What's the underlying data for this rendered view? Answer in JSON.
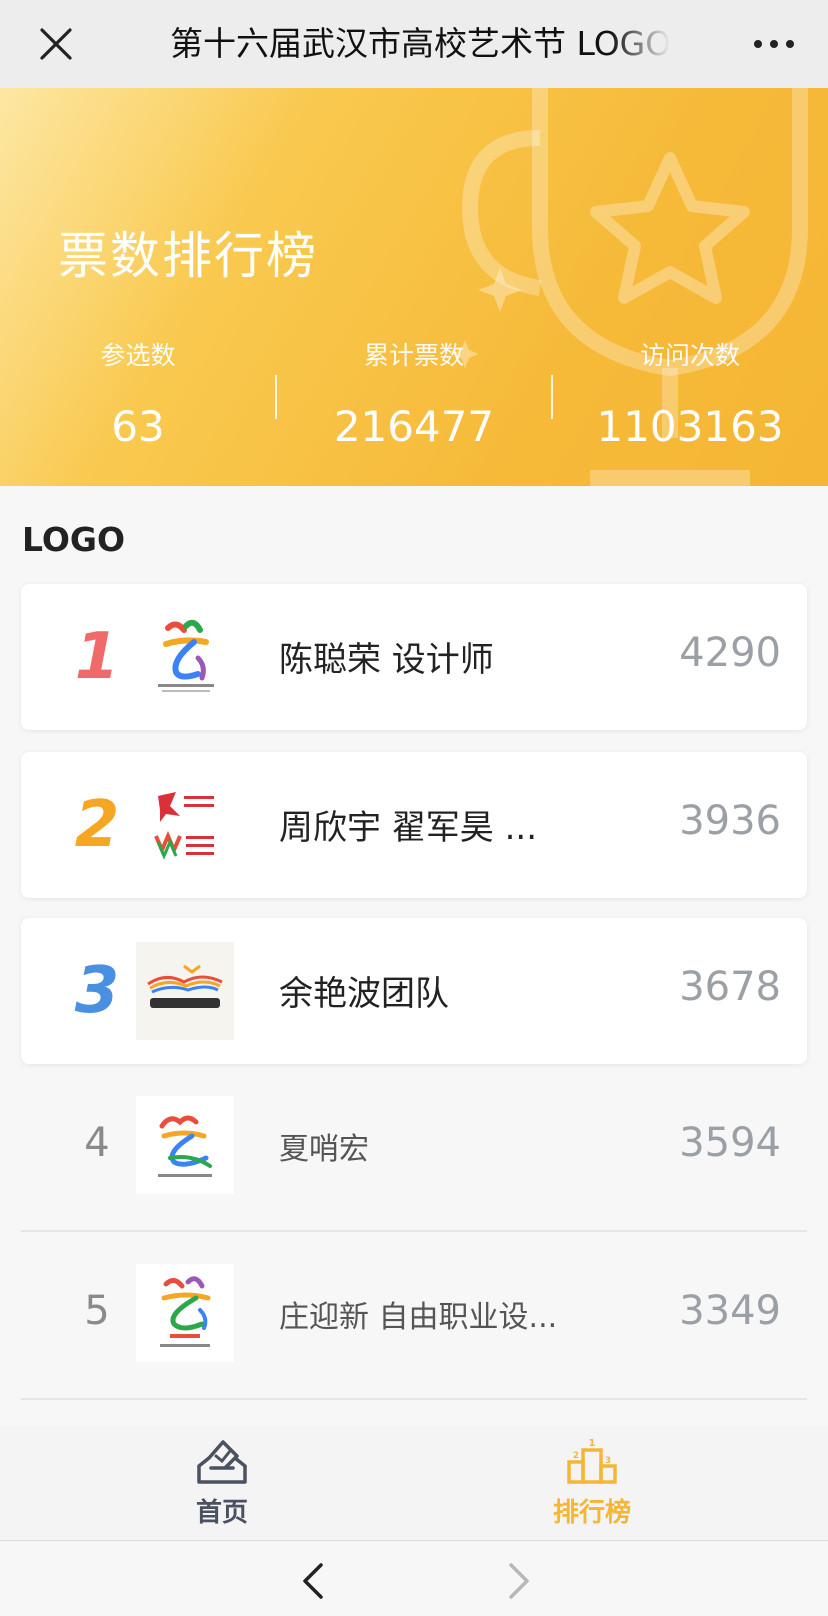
{
  "header": {
    "title": "第十六届武汉市高校艺术节 LOGO"
  },
  "banner": {
    "heading": "票数排行榜",
    "stats": [
      {
        "label": "参选数",
        "value": "63"
      },
      {
        "label": "累计票数",
        "value": "216477"
      },
      {
        "label": "访问次数",
        "value": "1103163"
      }
    ]
  },
  "section": {
    "title": "LOGO"
  },
  "ranking": [
    {
      "rank": "1",
      "name": "陈聪荣 设计师",
      "votes": "4290",
      "rank_color": "#f16a6a"
    },
    {
      "rank": "2",
      "name": "周欣宇 翟军昊 ...",
      "votes": "3936",
      "rank_color": "#f5a623"
    },
    {
      "rank": "3",
      "name": "余艳波团队",
      "votes": "3678",
      "rank_color": "#4a90e2"
    },
    {
      "rank": "4",
      "name": "夏哨宏",
      "votes": "3594"
    },
    {
      "rank": "5",
      "name": "庄迎新 自由职业设...",
      "votes": "3349"
    }
  ],
  "tabs": {
    "home": {
      "label": "首页",
      "icon": "ballot-box-icon"
    },
    "ranking": {
      "label": "排行榜",
      "icon": "podium-icon",
      "active": true,
      "color": "#f5b635"
    }
  },
  "browser_nav": {
    "back_icon": "chevron-left-icon",
    "forward_icon": "chevron-right-icon"
  }
}
